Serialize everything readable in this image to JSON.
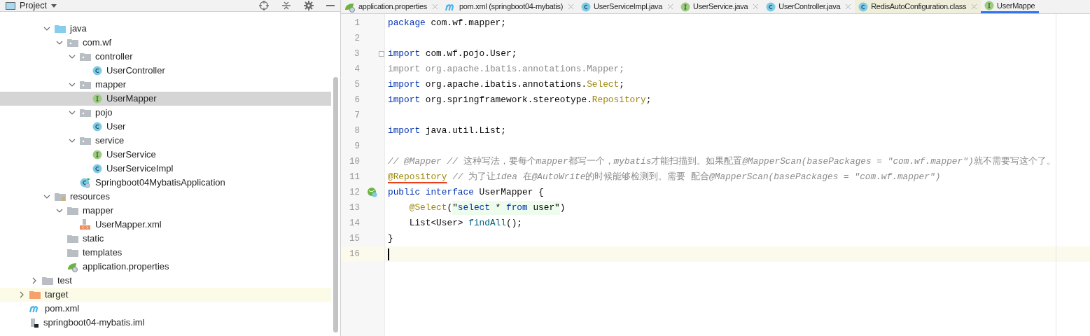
{
  "project_panel": {
    "title": "Project",
    "tree": [
      {
        "children": [
          {
            "children": [
              {
                "label": "java",
                "kind": "source-folder",
                "expanded": true,
                "selected": false,
                "excluded": false,
                "children": [
                  {
                    "label": "com.wf",
                    "kind": "package",
                    "expanded": true,
                    "selected": false,
                    "excluded": false,
                    "children": [
                      {
                        "label": "controller",
                        "kind": "package",
                        "expanded": true,
                        "selected": false,
                        "excluded": false,
                        "children": [
                          {
                            "label": "UserController",
                            "kind": "class",
                            "selected": false,
                            "excluded": false
                          }
                        ]
                      },
                      {
                        "label": "mapper",
                        "kind": "package",
                        "expanded": true,
                        "selected": false,
                        "excluded": false,
                        "children": [
                          {
                            "label": "UserMapper",
                            "kind": "interface",
                            "selected": true,
                            "excluded": false
                          }
                        ]
                      },
                      {
                        "label": "pojo",
                        "kind": "package",
                        "expanded": true,
                        "selected": false,
                        "excluded": false,
                        "children": [
                          {
                            "label": "User",
                            "kind": "class",
                            "selected": false,
                            "excluded": false
                          }
                        ]
                      },
                      {
                        "label": "service",
                        "kind": "package",
                        "expanded": true,
                        "selected": false,
                        "excluded": false,
                        "children": [
                          {
                            "label": "UserService",
                            "kind": "interface",
                            "selected": false,
                            "excluded": false
                          },
                          {
                            "label": "UserServiceImpl",
                            "kind": "class",
                            "selected": false,
                            "excluded": false
                          }
                        ]
                      },
                      {
                        "label": "Springboot04MybatisApplication",
                        "kind": "spring-app",
                        "selected": false,
                        "excluded": false
                      }
                    ]
                  }
                ]
              },
              {
                "label": "resources",
                "kind": "resources-folder",
                "expanded": true,
                "selected": false,
                "excluded": false,
                "children": [
                  {
                    "label": "mapper",
                    "kind": "folder",
                    "expanded": true,
                    "selected": false,
                    "excluded": false,
                    "children": [
                      {
                        "label": "UserMapper.xml",
                        "kind": "xml",
                        "selected": false,
                        "excluded": false
                      }
                    ]
                  },
                  {
                    "label": "static",
                    "kind": "folder",
                    "selected": false,
                    "excluded": false
                  },
                  {
                    "label": "templates",
                    "kind": "folder",
                    "selected": false,
                    "excluded": false
                  },
                  {
                    "label": "application.properties",
                    "kind": "properties",
                    "selected": false,
                    "excluded": false
                  }
                ]
              }
            ]
          },
          {
            "label": "test",
            "kind": "folder",
            "expanded": false,
            "selected": false,
            "excluded": false
          }
        ]
      },
      {
        "label": "target",
        "kind": "excluded-folder",
        "expanded": false,
        "selected": false,
        "excluded": true
      },
      {
        "label": "pom.xml",
        "kind": "maven",
        "selected": false,
        "excluded": false
      },
      {
        "label": "springboot04-mybatis.iml",
        "kind": "iml",
        "selected": false,
        "excluded": false
      }
    ]
  },
  "tabs": [
    {
      "label": "application.properties",
      "kind": "properties",
      "selected": false,
      "readonly": false
    },
    {
      "label": "pom.xml (springboot04-mybatis)",
      "kind": "maven",
      "selected": false,
      "readonly": false
    },
    {
      "label": "UserServiceImpl.java",
      "kind": "class",
      "selected": false,
      "readonly": false
    },
    {
      "label": "UserService.java",
      "kind": "interface",
      "selected": false,
      "readonly": false
    },
    {
      "label": "UserController.java",
      "kind": "class",
      "selected": false,
      "readonly": false
    },
    {
      "label": "RedisAutoConfiguration.class",
      "kind": "class",
      "selected": false,
      "readonly": true
    },
    {
      "label": "UserMappe",
      "kind": "interface",
      "selected": true,
      "readonly": false
    }
  ],
  "editor": {
    "lines": [
      {
        "number": "1",
        "current": false,
        "tokens": [
          {
            "kind": "keyword",
            "text": "package"
          },
          {
            "kind": "plain",
            "text": " com.wf.mapper;"
          }
        ]
      },
      {
        "number": "2",
        "current": false
      },
      {
        "number": "3",
        "current": false,
        "fold": true,
        "tokens": [
          {
            "kind": "keyword",
            "text": "import"
          },
          {
            "kind": "plain",
            "text": " com.wf.pojo.User;"
          }
        ]
      },
      {
        "number": "4",
        "current": false,
        "tokens": [
          {
            "kind": "unused",
            "text": "import org.apache.ibatis.annotations.Mapper;"
          }
        ]
      },
      {
        "number": "5",
        "current": false,
        "tokens": [
          {
            "kind": "keyword",
            "text": "import"
          },
          {
            "kind": "plain",
            "text": " org.apache.ibatis.annotations."
          },
          {
            "kind": "annotation",
            "text": "Select"
          },
          {
            "kind": "plain",
            "text": ";"
          }
        ]
      },
      {
        "number": "6",
        "current": false,
        "tokens": [
          {
            "kind": "keyword",
            "text": "import"
          },
          {
            "kind": "plain",
            "text": " org.springframework.stereotype."
          },
          {
            "kind": "annotation",
            "text": "Repository"
          },
          {
            "kind": "plain",
            "text": ";"
          }
        ]
      },
      {
        "number": "7",
        "current": false
      },
      {
        "number": "8",
        "current": false,
        "tokens": [
          {
            "kind": "keyword",
            "text": "import"
          },
          {
            "kind": "plain",
            "text": " java.util.List;"
          }
        ]
      },
      {
        "number": "9",
        "current": false
      },
      {
        "number": "10",
        "current": false,
        "tokens": [
          {
            "kind": "comment-italic",
            "text": "// @Mapper //"
          },
          {
            "kind": "comment",
            "text": " 这种写法，要每个"
          },
          {
            "kind": "comment-italic",
            "text": "mapper"
          },
          {
            "kind": "comment",
            "text": "都写一个，"
          },
          {
            "kind": "comment-italic",
            "text": "mybatis"
          },
          {
            "kind": "comment",
            "text": "才能扫描到。如果配置"
          },
          {
            "kind": "comment-italic",
            "text": "@MapperScan(basePackages = \"com.wf.mapper\")"
          },
          {
            "kind": "comment",
            "text": "就不需要写这个了。"
          }
        ]
      },
      {
        "number": "11",
        "current": false,
        "tokens": [
          {
            "kind": "annotation",
            "text": "@Repository",
            "underlined": true
          },
          {
            "kind": "comment-italic",
            "text": " //"
          },
          {
            "kind": "comment",
            "text": " 为了让"
          },
          {
            "kind": "comment-italic",
            "text": "idea"
          },
          {
            "kind": "comment",
            "text": " 在"
          },
          {
            "kind": "comment-italic",
            "text": "@AutoWrite"
          },
          {
            "kind": "comment",
            "text": "的时候能够检测到。需要 配合"
          },
          {
            "kind": "comment-italic",
            "text": "@MapperScan(basePackages = \"com.wf.mapper\")"
          }
        ]
      },
      {
        "number": "12",
        "current": false,
        "bean_marker": true,
        "tokens": [
          {
            "kind": "keyword",
            "text": "public"
          },
          {
            "kind": "keyword",
            "text": " interface"
          },
          {
            "kind": "plain",
            "text": " UserMapper {"
          }
        ]
      },
      {
        "number": "13",
        "current": false,
        "tokens": [
          {
            "kind": "annotation",
            "text": "    @Select"
          },
          {
            "kind": "plain",
            "text": "("
          },
          {
            "kind": "sql",
            "text": "\""
          },
          {
            "kind": "sql-keyword",
            "text": "select"
          },
          {
            "kind": "sql",
            "text": " * "
          },
          {
            "kind": "sql-keyword",
            "text": "from"
          },
          {
            "kind": "sql",
            "text": " user\""
          },
          {
            "kind": "plain",
            "text": ")"
          }
        ]
      },
      {
        "number": "14",
        "current": false,
        "tokens": [
          {
            "kind": "plain",
            "text": "    List<User> "
          },
          {
            "kind": "method",
            "text": "findAll"
          },
          {
            "kind": "plain",
            "text": "();"
          }
        ]
      },
      {
        "number": "15",
        "current": false,
        "tokens": [
          {
            "kind": "plain",
            "text": "}"
          }
        ]
      },
      {
        "number": "16",
        "current": true
      }
    ]
  }
}
